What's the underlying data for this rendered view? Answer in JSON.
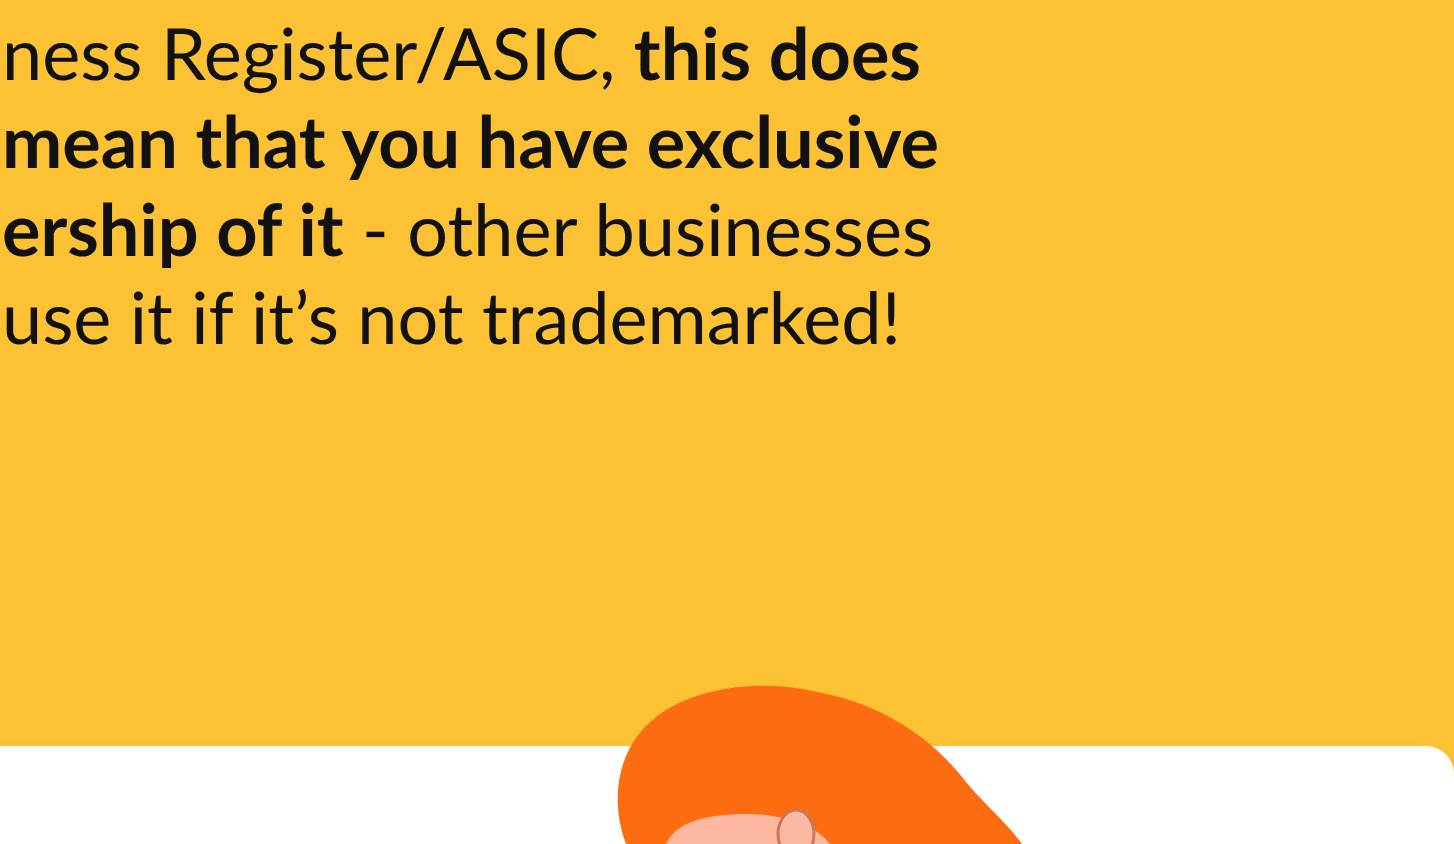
{
  "paragraph": {
    "lines": [
      "ness Register/ASIC, **this does**",
      "**mean that you have exclusive**",
      "**ership of it** - other businesses",
      "use it if it’s not trademarked!"
    ]
  }
}
